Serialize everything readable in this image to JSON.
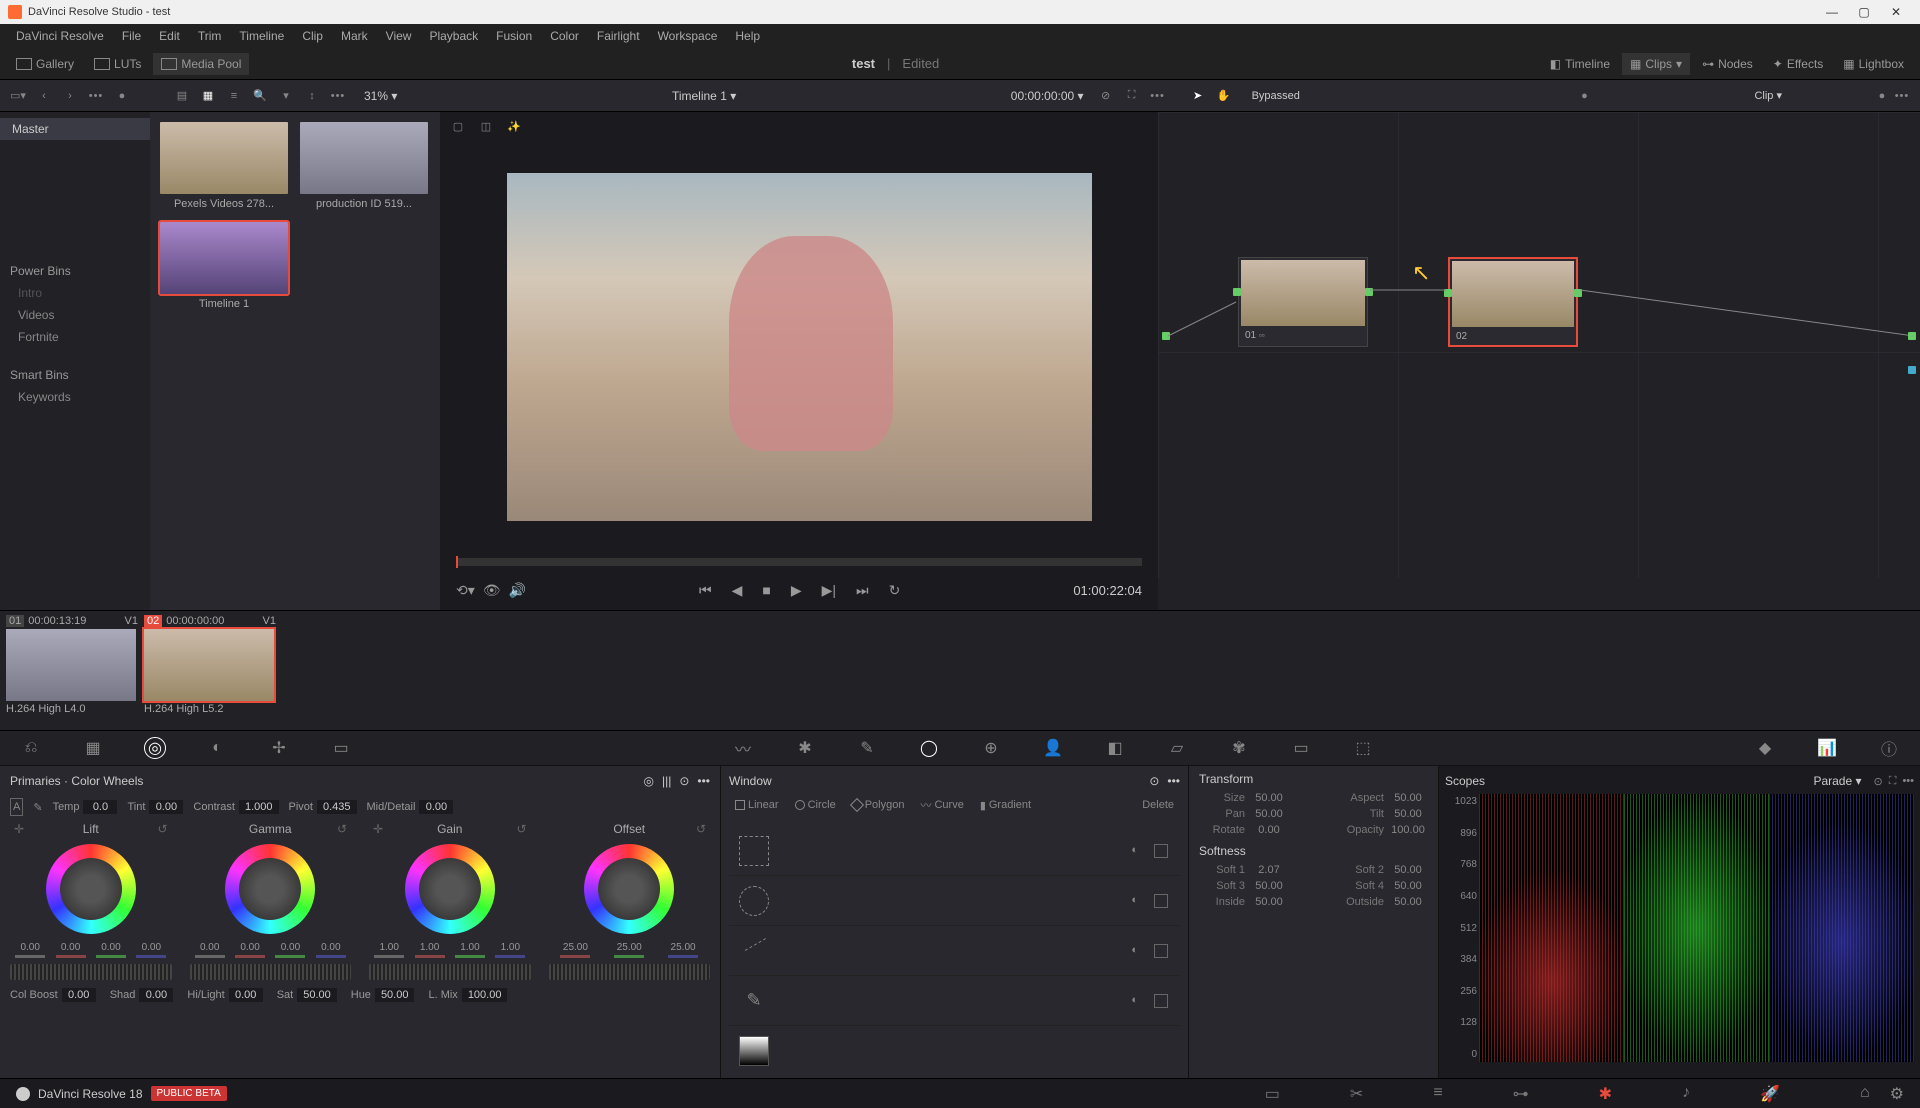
{
  "titlebar": {
    "text": "DaVinci Resolve Studio - test"
  },
  "menubar": [
    "DaVinci Resolve",
    "File",
    "Edit",
    "Trim",
    "Timeline",
    "Clip",
    "Mark",
    "View",
    "Playback",
    "Fusion",
    "Color",
    "Fairlight",
    "Workspace",
    "Help"
  ],
  "subbar": {
    "gallery": "Gallery",
    "luts": "LUTs",
    "mediapool": "Media Pool",
    "project_name": "test",
    "edited": "Edited",
    "timeline": "Timeline",
    "clips": "Clips",
    "nodes": "Nodes",
    "effects": "Effects",
    "lightbox": "Lightbox"
  },
  "topctrl": {
    "zoom": "31%",
    "timeline_name": "Timeline 1",
    "timecode": "00:00:00:00",
    "bypassed": "Bypassed",
    "clip": "Clip"
  },
  "bins": {
    "master": "Master",
    "powerbins": "Power Bins",
    "items": [
      "Intro",
      "Videos",
      "Fortnite"
    ],
    "smartbins": "Smart Bins",
    "smart_items": [
      "Keywords"
    ]
  },
  "clips": [
    {
      "label": "Pexels Videos 278..."
    },
    {
      "label": "production ID 519..."
    },
    {
      "label": "Timeline 1"
    }
  ],
  "viewer": {
    "duration": "01:00:22:04"
  },
  "nodes": {
    "n1": "01",
    "n2": "02"
  },
  "strip": [
    {
      "idx": "01",
      "tc": "00:00:13:19",
      "trk": "V1",
      "codec": "H.264 High L4.0"
    },
    {
      "idx": "02",
      "tc": "00:00:00:00",
      "trk": "V1",
      "codec": "H.264 High L5.2"
    }
  ],
  "primaries": {
    "title": "Primaries · Color Wheels",
    "temp_l": "Temp",
    "temp_v": "0.0",
    "tint_l": "Tint",
    "tint_v": "0.00",
    "contrast_l": "Contrast",
    "contrast_v": "1.000",
    "pivot_l": "Pivot",
    "pivot_v": "0.435",
    "mid_l": "Mid/Detail",
    "mid_v": "0.00",
    "wheels": {
      "lift": {
        "name": "Lift",
        "v": [
          "0.00",
          "0.00",
          "0.00",
          "0.00"
        ]
      },
      "gamma": {
        "name": "Gamma",
        "v": [
          "0.00",
          "0.00",
          "0.00",
          "0.00"
        ]
      },
      "gain": {
        "name": "Gain",
        "v": [
          "1.00",
          "1.00",
          "1.00",
          "1.00"
        ]
      },
      "offset": {
        "name": "Offset",
        "v": [
          "25.00",
          "25.00",
          "25.00"
        ]
      }
    },
    "row2": {
      "colboost_l": "Col Boost",
      "colboost_v": "0.00",
      "shad_l": "Shad",
      "shad_v": "0.00",
      "hilight_l": "Hi/Light",
      "hilight_v": "0.00",
      "sat_l": "Sat",
      "sat_v": "50.00",
      "hue_l": "Hue",
      "hue_v": "50.00",
      "lmix_l": "L. Mix",
      "lmix_v": "100.00"
    }
  },
  "window": {
    "title": "Window",
    "tabs": [
      "Linear",
      "Circle",
      "Polygon",
      "Curve",
      "Gradient",
      "Delete"
    ]
  },
  "transform": {
    "title": "Transform",
    "size_l": "Size",
    "size_v": "50.00",
    "aspect_l": "Aspect",
    "aspect_v": "50.00",
    "pan_l": "Pan",
    "pan_v": "50.00",
    "tilt_l": "Tilt",
    "tilt_v": "50.00",
    "rotate_l": "Rotate",
    "rotate_v": "0.00",
    "opacity_l": "Opacity",
    "opacity_v": "100.00",
    "softness": "Softness",
    "s1_l": "Soft 1",
    "s1_v": "2.07",
    "s2_l": "Soft 2",
    "s2_v": "50.00",
    "s3_l": "Soft 3",
    "s3_v": "50.00",
    "s4_l": "Soft 4",
    "s4_v": "50.00",
    "in_l": "Inside",
    "in_v": "50.00",
    "out_l": "Outside",
    "out_v": "50.00"
  },
  "scopes": {
    "title": "Scopes",
    "mode": "Parade",
    "ticks": [
      "1023",
      "896",
      "768",
      "640",
      "512",
      "384",
      "256",
      "128",
      "0"
    ]
  },
  "footer": {
    "app": "DaVinci Resolve 18",
    "badge": "PUBLIC BETA"
  }
}
